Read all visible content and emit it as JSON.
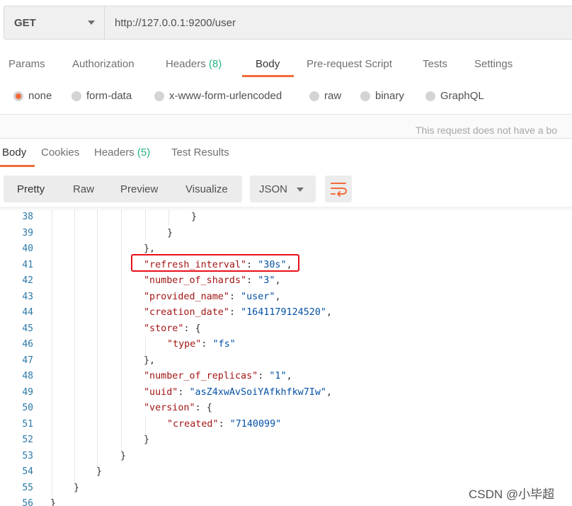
{
  "request": {
    "method": "GET",
    "url": "http://127.0.0.1:9200/user"
  },
  "request_tabs": [
    {
      "label": "Params"
    },
    {
      "label": "Authorization"
    },
    {
      "label": "Headers",
      "count": "(8)"
    },
    {
      "label": "Body",
      "active": true
    },
    {
      "label": "Pre-request Script"
    },
    {
      "label": "Tests"
    },
    {
      "label": "Settings"
    }
  ],
  "body_types": [
    {
      "label": "none",
      "selected": true
    },
    {
      "label": "form-data"
    },
    {
      "label": "x-www-form-urlencoded"
    },
    {
      "label": "raw"
    },
    {
      "label": "binary"
    },
    {
      "label": "GraphQL"
    }
  ],
  "no_body_note": "This request does not have a bo",
  "response_tabs": [
    {
      "label": "Body",
      "active": true
    },
    {
      "label": "Cookies"
    },
    {
      "label": "Headers",
      "count": "(5)"
    },
    {
      "label": "Test Results"
    }
  ],
  "view_modes": [
    "Pretty",
    "Raw",
    "Preview",
    "Visualize"
  ],
  "format": "JSON",
  "icons": {
    "wrap": "wrap-lines-icon",
    "method_caret": "chevron-down-icon",
    "format_caret": "chevron-down-icon"
  },
  "colors": {
    "accent": "#f26b3a",
    "count": "#26b47f",
    "highlight_box": "#e8101a",
    "key": "#a31515",
    "string": "#0451a5",
    "line_number": "#2b79a9"
  },
  "code_lines": [
    {
      "n": "38",
      "text": "}"
    },
    {
      "n": "39",
      "text": "}"
    },
    {
      "n": "40",
      "text": "},"
    },
    {
      "n": "41",
      "key": "\"refresh_interval\"",
      "sep": ": ",
      "value": "\"30s\"",
      "end": ","
    },
    {
      "n": "42",
      "key": "\"number_of_shards\"",
      "sep": ": ",
      "value": "\"3\"",
      "end": ","
    },
    {
      "n": "43",
      "key": "\"provided_name\"",
      "sep": ": ",
      "value": "\"user\"",
      "end": ","
    },
    {
      "n": "44",
      "key": "\"creation_date\"",
      "sep": ": ",
      "value": "\"1641179124520\"",
      "end": ","
    },
    {
      "n": "45",
      "key": "\"store\"",
      "sep": ": ",
      "value": "",
      "end": "{"
    },
    {
      "n": "46",
      "key": "\"type\"",
      "sep": ": ",
      "value": "\"fs\"",
      "end": ""
    },
    {
      "n": "47",
      "text": "},"
    },
    {
      "n": "48",
      "key": "\"number_of_replicas\"",
      "sep": ": ",
      "value": "\"1\"",
      "end": ","
    },
    {
      "n": "49",
      "key": "\"uuid\"",
      "sep": ": ",
      "value": "\"asZ4xwAvSoiYAfkhfkw7Iw\"",
      "end": ","
    },
    {
      "n": "50",
      "key": "\"version\"",
      "sep": ": ",
      "value": "",
      "end": "{"
    },
    {
      "n": "51",
      "key": "\"created\"",
      "sep": ": ",
      "value": "\"7140099\"",
      "end": ""
    },
    {
      "n": "52",
      "text": "}"
    },
    {
      "n": "53",
      "text": "}"
    },
    {
      "n": "54",
      "text": "}"
    },
    {
      "n": "55",
      "text": "}"
    },
    {
      "n": "56",
      "text": "}"
    }
  ],
  "watermark": "CSDN @小毕超"
}
